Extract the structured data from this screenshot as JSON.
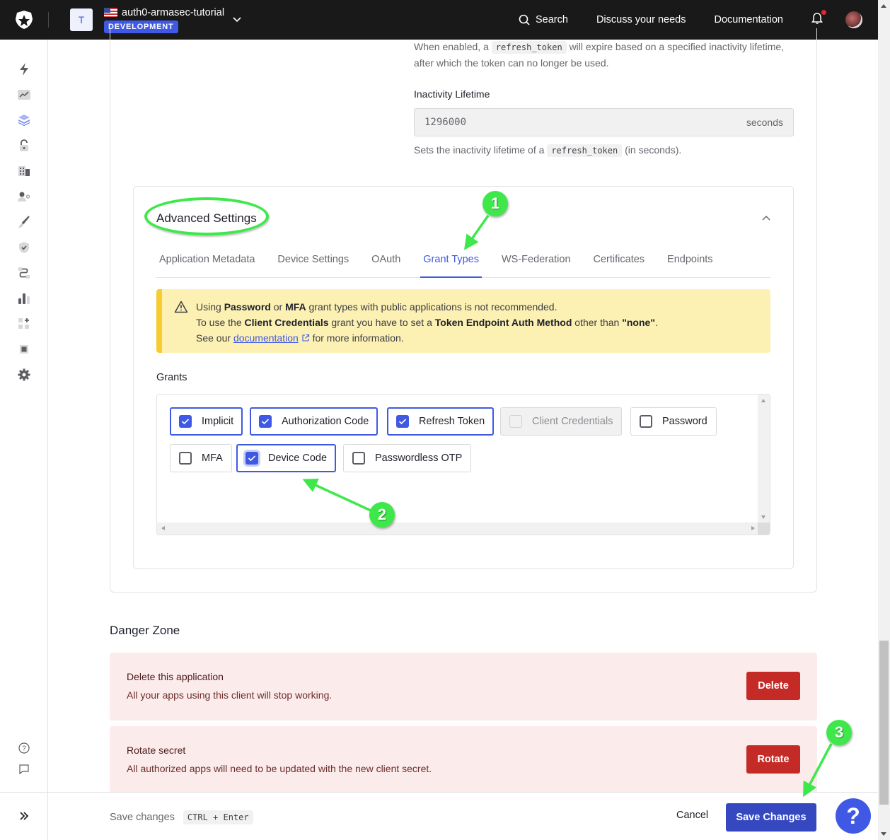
{
  "topbar": {
    "tenant_initial": "T",
    "tenant_name": "auth0-armasec-tutorial",
    "environment_badge": "DEVELOPMENT",
    "search_label": "Search",
    "discuss_label": "Discuss your needs",
    "documentation_label": "Documentation",
    "has_notification": true
  },
  "sidebar": {
    "items": [
      {
        "icon": "lightning-icon",
        "label": "Getting Started"
      },
      {
        "icon": "activity-chart-icon",
        "label": "Activity"
      },
      {
        "icon": "layers-icon",
        "label": "Applications",
        "active": true
      },
      {
        "icon": "lock-icon",
        "label": "Authentication"
      },
      {
        "icon": "organizations-icon",
        "label": "Organizations"
      },
      {
        "icon": "user-management-icon",
        "label": "User Management"
      },
      {
        "icon": "brush-icon",
        "label": "Branding"
      },
      {
        "icon": "shield-check-icon",
        "label": "Security"
      },
      {
        "icon": "actions-flow-icon",
        "label": "Actions"
      },
      {
        "icon": "bar-chart-icon",
        "label": "Monitoring"
      },
      {
        "icon": "marketplace-icon",
        "label": "Marketplace"
      },
      {
        "icon": "extensions-chip-icon",
        "label": "Extensions"
      },
      {
        "icon": "gear-icon",
        "label": "Settings"
      }
    ],
    "bottom": [
      {
        "icon": "help-circle-icon",
        "label": "Help"
      },
      {
        "icon": "feedback-icon",
        "label": "Feedback"
      }
    ]
  },
  "refresh_expiry": {
    "description_prefix": "When enabled, a",
    "description_code": "refresh_token",
    "description_suffix": "will expire based on a specified inactivity lifetime, after which the token can no longer be used.",
    "field_label": "Inactivity Lifetime",
    "field_value": "1296000",
    "field_suffix": "seconds",
    "help_prefix": "Sets the inactivity lifetime of a",
    "help_code": "refresh_token",
    "help_suffix": "(in seconds)."
  },
  "advanced_settings": {
    "title": "Advanced Settings",
    "expanded": true,
    "tabs": [
      {
        "label": "Application Metadata",
        "active": false
      },
      {
        "label": "Device Settings",
        "active": false
      },
      {
        "label": "OAuth",
        "active": false
      },
      {
        "label": "Grant Types",
        "active": true
      },
      {
        "label": "WS-Federation",
        "active": false
      },
      {
        "label": "Certificates",
        "active": false
      },
      {
        "label": "Endpoints",
        "active": false
      }
    ],
    "alert": {
      "line1_a": "Using",
      "line1_b": "Password",
      "line1_c": "or",
      "line1_d": "MFA",
      "line1_e": "grant types with public applications is not recommended.",
      "line2_a": "To use the",
      "line2_b": "Client Credentials",
      "line2_c": "grant you have to set a",
      "line2_d": "Token Endpoint Auth Method",
      "line2_e": "other than",
      "line2_f": "\"none\"",
      "line2_g": ".",
      "line3_a": "See our",
      "line3_link": "documentation",
      "line3_b": "for more information."
    },
    "grants_label": "Grants",
    "grants": [
      {
        "label": "Implicit",
        "checked": true,
        "disabled": false
      },
      {
        "label": "Authorization Code",
        "checked": true,
        "disabled": false
      },
      {
        "label": "Refresh Token",
        "checked": true,
        "disabled": false
      },
      {
        "label": "Client Credentials",
        "checked": false,
        "disabled": true
      },
      {
        "label": "Password",
        "checked": false,
        "disabled": false
      },
      {
        "label": "MFA",
        "checked": false,
        "disabled": false
      },
      {
        "label": "Device Code",
        "checked": true,
        "disabled": false
      },
      {
        "label": "Passwordless OTP",
        "checked": false,
        "disabled": false
      }
    ]
  },
  "annotations": {
    "step1": "1",
    "step2": "2",
    "step3": "3",
    "color": "#3fe84a"
  },
  "danger_zone": {
    "title": "Danger Zone",
    "items": [
      {
        "title": "Delete this application",
        "description": "All your apps using this client will stop working.",
        "button": "Delete"
      },
      {
        "title": "Rotate secret",
        "description": "All authorized apps will need to be updated with the new client secret.",
        "button": "Rotate"
      }
    ]
  },
  "footer": {
    "hint_label": "Save changes",
    "shortcut": "CTRL + Enter",
    "cancel_label": "Cancel",
    "save_label": "Save Changes",
    "help_label": "?"
  },
  "colors": {
    "accent": "#3f59e4",
    "save_button": "#3548c0",
    "danger": "#c42b27",
    "danger_bg": "#fbeceb",
    "alert_bg": "#fcf0b3",
    "alert_border": "#f7cc2e",
    "topbar_bg": "#191919"
  }
}
